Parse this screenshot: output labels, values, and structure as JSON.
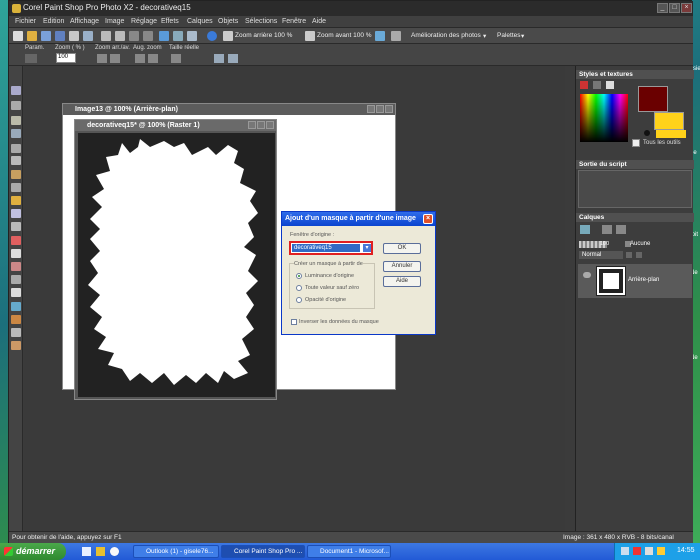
{
  "desktop": {
    "right_edge_text": [
      "ssier",
      "ée",
      "tpit",
      "Ne",
      "Ne"
    ]
  },
  "app": {
    "title": "Corel Paint Shop Pro Photo X2 - decorativeq15",
    "menu": [
      "Fichier",
      "Edition",
      "Affichage",
      "Image",
      "Réglage",
      "Effets",
      "Calques",
      "Objets",
      "Sélections",
      "Fenêtre",
      "Aide"
    ],
    "toolbar1": {
      "zoom_out": "Zoom arrière 100 %",
      "zoom_in": "Zoom avant 100 %",
      "enhance": "Amélioration des photos",
      "palettes": "Palettes"
    },
    "toolbar2": {
      "param": "Param.",
      "zoom_pct": "Zoom ( % )",
      "zoom_value": "100",
      "zoom_av": "Zoom arr./av.",
      "aug_zoom": "Aug. zoom",
      "real_size": "Taille réelle"
    },
    "status_text": "Pour obtenir de l'aide, appuyez sur F1",
    "status_image": "Image : 361 x 480 x RVB - 8 bits/canal"
  },
  "windows": {
    "back": {
      "title": "Image13 @ 100% (Arrière-plan)"
    },
    "front": {
      "title": "decorativeq15* @ 100% (Raster 1)"
    }
  },
  "dialog": {
    "title": "Ajout d'un masque à partir d'une image",
    "source_label": "Fenêtre d'origine :",
    "source_value": "decorativeq15",
    "ok": "OK",
    "cancel": "Annuler",
    "help": "Aide",
    "create_from": "Créer un masque à partir de",
    "opt1": "Luminance d'origine",
    "opt2": "Toute valeur sauf zéro",
    "opt3": "Opacité d'origine",
    "invert": "Inverser les données du masque"
  },
  "palettes": {
    "styles_title": "Styles et textures",
    "all_tools": "Tous les outils",
    "script_title": "Sortie du script",
    "layers_title": "Calques",
    "opacity": "100",
    "blend_none": "Aucune",
    "blend_mode": "Normal",
    "layer_name": "Arrière-plan"
  },
  "taskbar": {
    "start": "démarrer",
    "tasks": [
      "Outlook (1) - gisele76...",
      "Corel Paint Shop Pro ...",
      "Document1 - Microsof..."
    ],
    "time": "14:55"
  },
  "colors": {
    "accent": "#0a44cf",
    "foreground": "#6a0000",
    "background": "#ffd21a"
  }
}
